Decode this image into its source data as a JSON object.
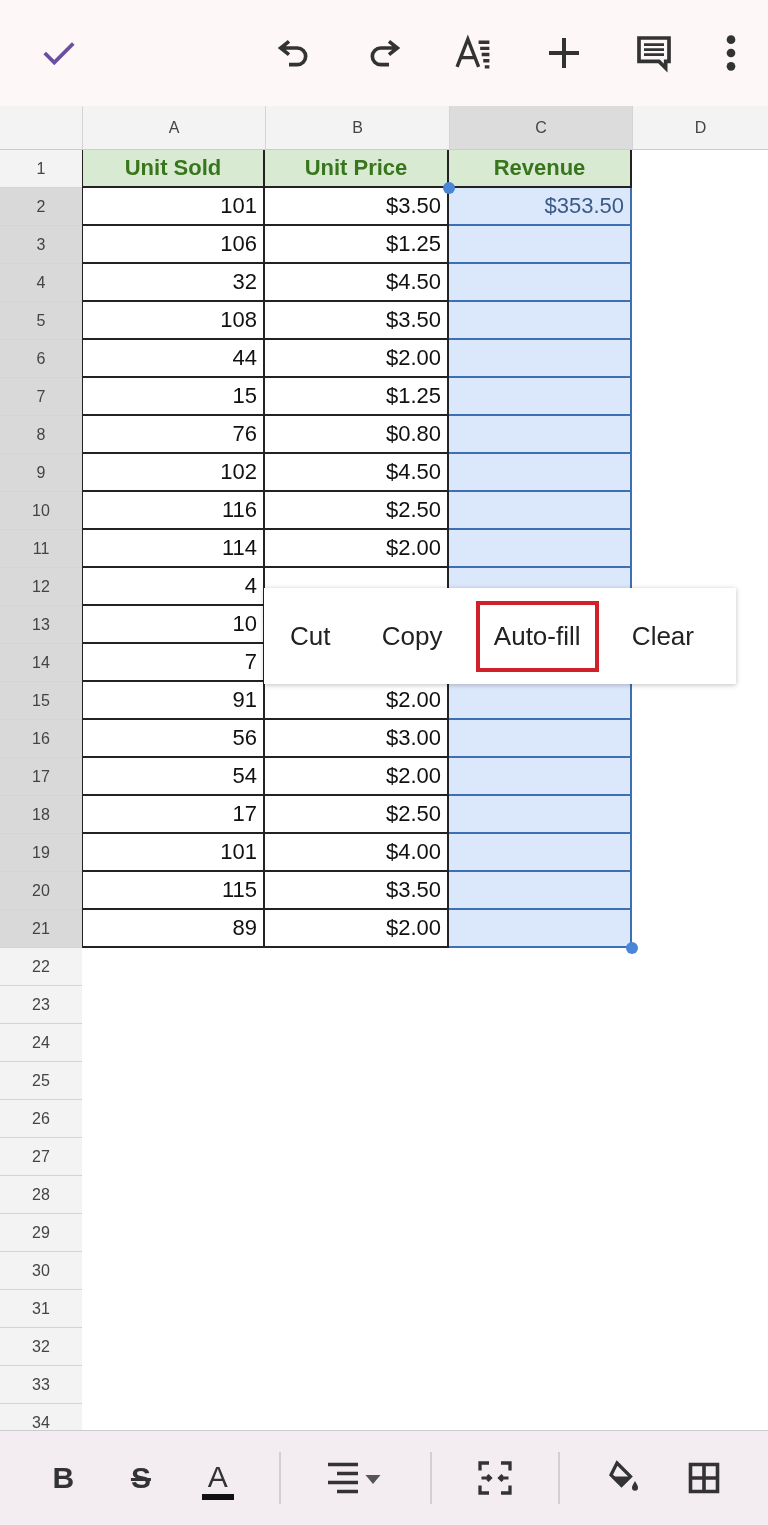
{
  "columns": [
    {
      "label": "A",
      "selected": false
    },
    {
      "label": "B",
      "selected": false
    },
    {
      "label": "C",
      "selected": true
    },
    {
      "label": "D",
      "selected": false
    }
  ],
  "rows": [
    {
      "number": "1",
      "kind": "header",
      "selected": false,
      "cells": [
        {
          "text": "Unit Sold",
          "selected": false
        },
        {
          "text": "Unit Price",
          "selected": false
        },
        {
          "text": "Revenue",
          "selected": false
        }
      ]
    },
    {
      "number": "2",
      "kind": "data",
      "selected": true,
      "cells": [
        {
          "text": "101",
          "selected": false
        },
        {
          "text": "$3.50",
          "selected": false
        },
        {
          "text": "$353.50",
          "selected": true
        }
      ]
    },
    {
      "number": "3",
      "kind": "data",
      "selected": true,
      "cells": [
        {
          "text": "106",
          "selected": false
        },
        {
          "text": "$1.25",
          "selected": false
        },
        {
          "selected": true
        }
      ]
    },
    {
      "number": "4",
      "kind": "data",
      "selected": true,
      "cells": [
        {
          "text": "32",
          "selected": false
        },
        {
          "text": "$4.50",
          "selected": false
        },
        {
          "selected": true
        }
      ]
    },
    {
      "number": "5",
      "kind": "data",
      "selected": true,
      "cells": [
        {
          "text": "108",
          "selected": false
        },
        {
          "text": "$3.50",
          "selected": false
        },
        {
          "selected": true
        }
      ]
    },
    {
      "number": "6",
      "kind": "data",
      "selected": true,
      "cells": [
        {
          "text": "44",
          "selected": false
        },
        {
          "text": "$2.00",
          "selected": false
        },
        {
          "selected": true
        }
      ]
    },
    {
      "number": "7",
      "kind": "data",
      "selected": true,
      "cells": [
        {
          "text": "15",
          "selected": false
        },
        {
          "text": "$1.25",
          "selected": false
        },
        {
          "selected": true
        }
      ]
    },
    {
      "number": "8",
      "kind": "data",
      "selected": true,
      "cells": [
        {
          "text": "76",
          "selected": false
        },
        {
          "text": "$0.80",
          "selected": false
        },
        {
          "selected": true
        }
      ]
    },
    {
      "number": "9",
      "kind": "data",
      "selected": true,
      "cells": [
        {
          "text": "102",
          "selected": false
        },
        {
          "text": "$4.50",
          "selected": false
        },
        {
          "selected": true
        }
      ]
    },
    {
      "number": "10",
      "kind": "data",
      "selected": true,
      "cells": [
        {
          "text": "116",
          "selected": false
        },
        {
          "text": "$2.50",
          "selected": false
        },
        {
          "selected": true
        }
      ]
    },
    {
      "number": "11",
      "kind": "data",
      "selected": true,
      "cells": [
        {
          "text": "114",
          "selected": false
        },
        {
          "text": "$2.00",
          "selected": false
        },
        {
          "selected": true
        }
      ]
    },
    {
      "number": "12",
      "kind": "data",
      "selected": true,
      "cells": [
        {
          "text": "4",
          "selected": false
        },
        {
          "selected": false
        },
        {
          "selected": true
        }
      ]
    },
    {
      "number": "13",
      "kind": "data",
      "selected": true,
      "cells": [
        {
          "text": "10",
          "selected": false
        }
      ]
    },
    {
      "number": "14",
      "kind": "data",
      "selected": true,
      "cells": [
        {
          "text": "7",
          "selected": false
        }
      ]
    },
    {
      "number": "15",
      "kind": "data",
      "selected": true,
      "cells": [
        {
          "text": "91",
          "selected": false
        },
        {
          "text": "$2.00",
          "selected": false
        },
        {
          "selected": true
        }
      ]
    },
    {
      "number": "16",
      "kind": "data",
      "selected": true,
      "cells": [
        {
          "text": "56",
          "selected": false
        },
        {
          "text": "$3.00",
          "selected": false
        },
        {
          "selected": true
        }
      ]
    },
    {
      "number": "17",
      "kind": "data",
      "selected": true,
      "cells": [
        {
          "text": "54",
          "selected": false
        },
        {
          "text": "$2.00",
          "selected": false
        },
        {
          "selected": true
        }
      ]
    },
    {
      "number": "18",
      "kind": "data",
      "selected": true,
      "cells": [
        {
          "text": "17",
          "selected": false
        },
        {
          "text": "$2.50",
          "selected": false
        },
        {
          "selected": true
        }
      ]
    },
    {
      "number": "19",
      "kind": "data",
      "selected": true,
      "cells": [
        {
          "text": "101",
          "selected": false
        },
        {
          "text": "$4.00",
          "selected": false
        },
        {
          "selected": true
        }
      ]
    },
    {
      "number": "20",
      "kind": "data",
      "selected": true,
      "cells": [
        {
          "text": "115",
          "selected": false
        },
        {
          "text": "$3.50",
          "selected": false
        },
        {
          "selected": true
        }
      ]
    },
    {
      "number": "21",
      "kind": "data",
      "selected": true,
      "cells": [
        {
          "text": "89",
          "selected": false
        },
        {
          "text": "$2.00",
          "selected": false
        },
        {
          "selected": true
        }
      ]
    },
    {
      "number": "22",
      "kind": "empty",
      "selected": false
    },
    {
      "number": "23",
      "kind": "empty",
      "selected": false
    },
    {
      "number": "24",
      "kind": "empty",
      "selected": false
    },
    {
      "number": "25",
      "kind": "empty",
      "selected": false
    },
    {
      "number": "26",
      "kind": "empty",
      "selected": false
    },
    {
      "number": "27",
      "kind": "empty",
      "selected": false
    },
    {
      "number": "28",
      "kind": "empty",
      "selected": false
    },
    {
      "number": "29",
      "kind": "empty",
      "selected": false
    },
    {
      "number": "30",
      "kind": "empty",
      "selected": false
    },
    {
      "number": "31",
      "kind": "empty",
      "selected": false
    },
    {
      "number": "32",
      "kind": "empty",
      "selected": false
    },
    {
      "number": "33",
      "kind": "empty",
      "selected": false
    },
    {
      "number": "34",
      "kind": "empty",
      "selected": false
    }
  ],
  "context_menu": [
    {
      "label": "Cut",
      "selected": false
    },
    {
      "label": "Copy",
      "selected": false
    },
    {
      "label": "Auto-fill",
      "selected": true
    },
    {
      "label": "Clear",
      "selected": false
    }
  ],
  "format_bar": [
    {
      "kind": "bold",
      "label": "B"
    },
    {
      "kind": "strike",
      "label": "S"
    },
    {
      "kind": "color",
      "label": "A"
    }
  ]
}
